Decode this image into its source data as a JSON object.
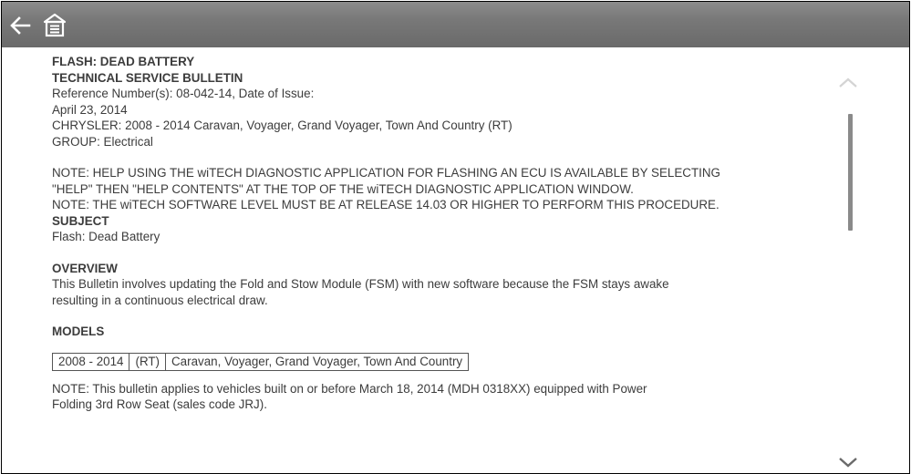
{
  "toolbar": {
    "back_icon": "back-arrow-icon",
    "home_icon": "home-icon"
  },
  "bulletin": {
    "title": "FLASH: DEAD BATTERY",
    "type": "TECHNICAL SERVICE BULLETIN",
    "reference": "Reference Number(s): 08-042-14, Date of Issue:",
    "date": "April 23, 2014",
    "vehicles": "CHRYSLER: 2008 - 2014 Caravan, Voyager, Grand Voyager, Town And Country (RT)",
    "group": "GROUP: Electrical",
    "note_help_1": "NOTE: HELP USING THE wiTECH DIAGNOSTIC APPLICATION FOR FLASHING AN ECU IS AVAILABLE BY SELECTING",
    "note_help_2": "\"HELP\" THEN \"HELP CONTENTS\" AT THE TOP OF THE wiTECH DIAGNOSTIC APPLICATION WINDOW.",
    "note_software": "NOTE: THE wiTECH SOFTWARE LEVEL MUST BE AT RELEASE 14.03 OR HIGHER TO PERFORM THIS PROCEDURE.",
    "subject_heading": "SUBJECT",
    "subject_text": "Flash: Dead Battery",
    "overview_heading": "OVERVIEW",
    "overview_line_1": "This Bulletin involves updating the Fold and Stow Module (FSM) with new software because the FSM stays awake",
    "overview_line_2": "resulting in a continuous electrical draw.",
    "models_heading": "MODELS",
    "models_table": {
      "years": "2008 - 2014",
      "code": "(RT)",
      "models": "Caravan, Voyager, Grand Voyager, Town And Country"
    },
    "note_applies_1": "NOTE: This bulletin applies to vehicles built on or before March 18, 2014 (MDH 0318XX) equipped with Power",
    "note_applies_2": "Folding 3rd Row Seat (sales code JRJ)."
  },
  "scrollbar": {
    "up_icon": "chevron-up-icon",
    "down_icon": "chevron-down-icon"
  },
  "colors": {
    "toolbar": "#787878",
    "text": "#3c3c3c",
    "scroll_thumb": "#8a8a8a"
  }
}
